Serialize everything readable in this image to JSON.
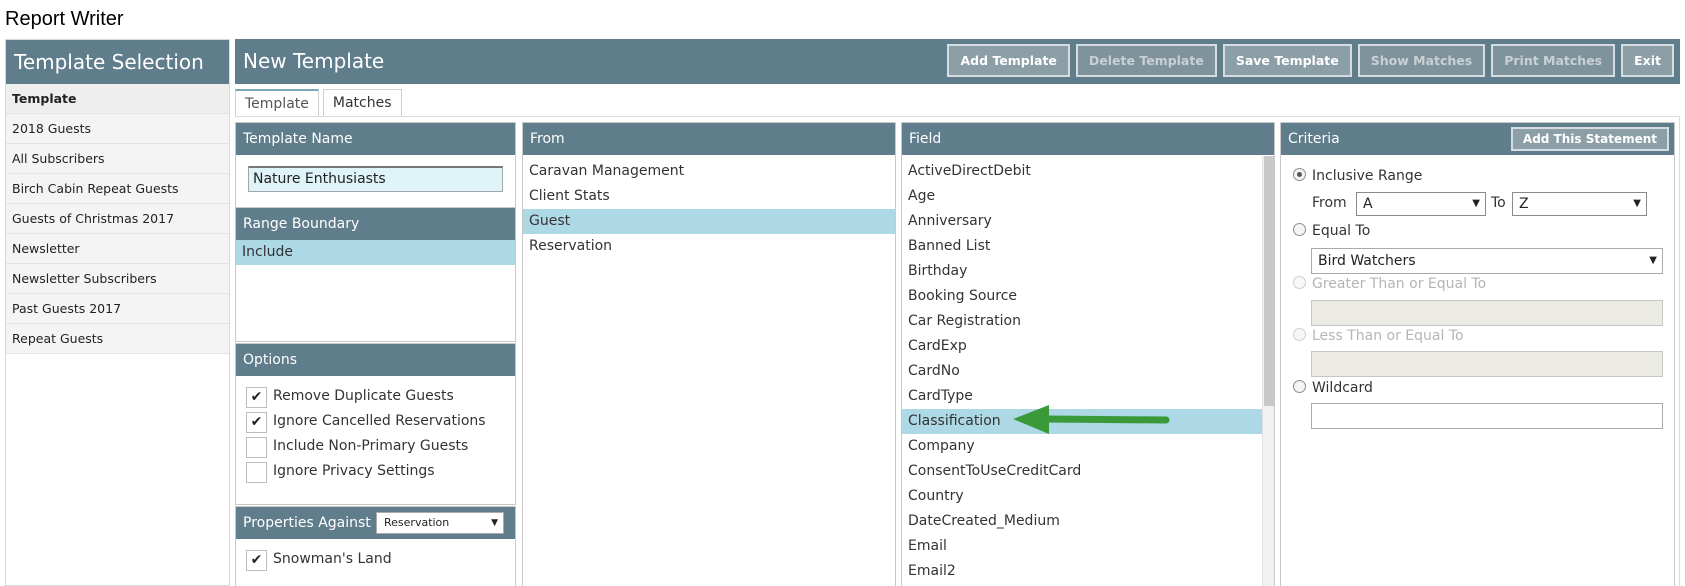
{
  "app": {
    "title": "Report Writer"
  },
  "sidebar": {
    "header": "Template Selection",
    "items": [
      {
        "label": "Template"
      },
      {
        "label": "2018 Guests"
      },
      {
        "label": "All Subscribers"
      },
      {
        "label": "Birch Cabin Repeat Guests"
      },
      {
        "label": "Guests of Christmas 2017"
      },
      {
        "label": "Newsletter"
      },
      {
        "label": "Newsletter Subscribers"
      },
      {
        "label": "Past Guests 2017"
      },
      {
        "label": "Repeat Guests"
      }
    ]
  },
  "header": {
    "title": "New Template",
    "buttons": {
      "add": "Add Template",
      "delete": "Delete Template",
      "save": "Save Template",
      "show": "Show Matches",
      "print": "Print Matches",
      "exit": "Exit"
    }
  },
  "tabs": {
    "template": "Template",
    "matches": "Matches"
  },
  "template_name": {
    "header": "Template Name",
    "value": "Nature Enthusiasts"
  },
  "range_boundary": {
    "header": "Range Boundary",
    "items": [
      {
        "label": "Include"
      }
    ]
  },
  "options": {
    "header": "Options",
    "items": [
      {
        "label": "Remove Duplicate Guests",
        "check": "✔"
      },
      {
        "label": "Ignore Cancelled Reservations",
        "check": "✔"
      },
      {
        "label": "Include Non-Primary Guests",
        "check": ""
      },
      {
        "label": "Ignore Privacy Settings",
        "check": ""
      }
    ]
  },
  "properties": {
    "label": "Properties Against",
    "selected": "Reservation",
    "items": [
      {
        "label": "Snowman's Land",
        "check": "✔"
      }
    ]
  },
  "from": {
    "header": "From",
    "items": [
      {
        "label": "Caravan Management"
      },
      {
        "label": "Client Stats"
      },
      {
        "label": "Guest"
      },
      {
        "label": "Reservation"
      }
    ]
  },
  "field": {
    "header": "Field",
    "items": [
      {
        "label": "ActiveDirectDebit"
      },
      {
        "label": "Age"
      },
      {
        "label": "Anniversary"
      },
      {
        "label": "Banned List"
      },
      {
        "label": "Birthday"
      },
      {
        "label": "Booking Source"
      },
      {
        "label": "Car Registration"
      },
      {
        "label": "CardExp"
      },
      {
        "label": "CardNo"
      },
      {
        "label": "CardType"
      },
      {
        "label": "Classification"
      },
      {
        "label": "Company"
      },
      {
        "label": "ConsentToUseCreditCard"
      },
      {
        "label": "Country"
      },
      {
        "label": "DateCreated_Medium"
      },
      {
        "label": "Email"
      },
      {
        "label": "Email2"
      }
    ]
  },
  "criteria": {
    "header": "Criteria",
    "add_button": "Add This Statement",
    "inclusive_range": "Inclusive Range",
    "from_label": "From",
    "from_value": "A",
    "to_label": "To",
    "to_value": "Z",
    "equal_to": "Equal To",
    "equal_value": "Bird Watchers",
    "greater": "Greater Than or Equal To",
    "less": "Less Than or Equal To",
    "wildcard": "Wildcard"
  },
  "colors": {
    "header_bg": "#607d8b",
    "selected_row": "#add8e6",
    "annotation_arrow": "#3a9a3a"
  }
}
